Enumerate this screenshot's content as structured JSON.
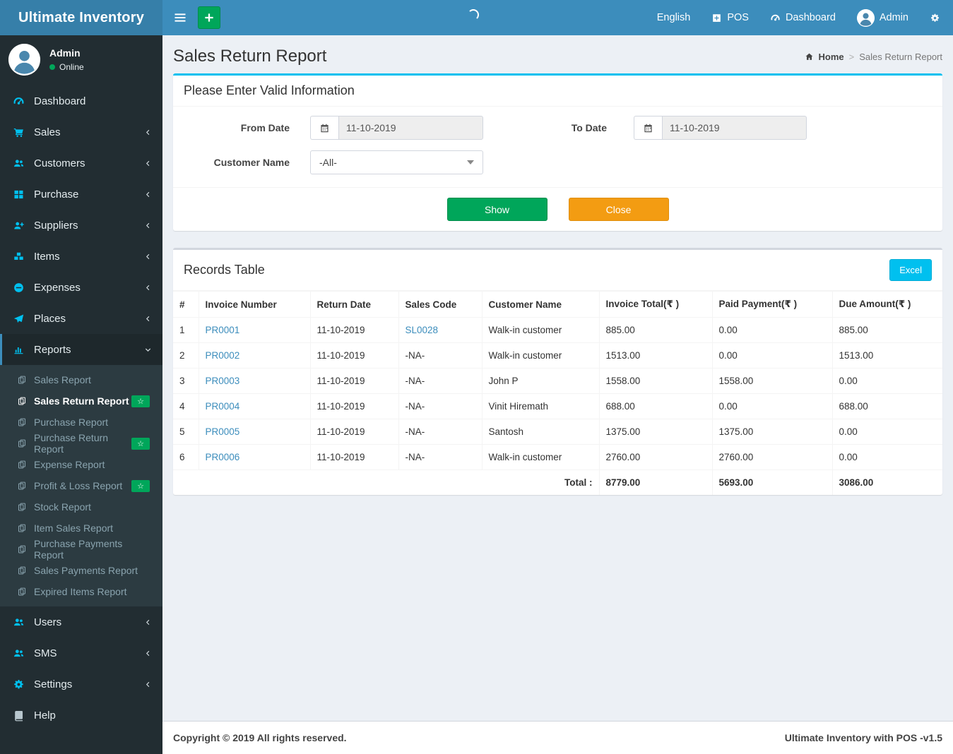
{
  "navbar": {
    "brand": "Ultimate Inventory",
    "language": "English",
    "pos_label": "POS",
    "dashboard_label": "Dashboard",
    "user_name": "Admin"
  },
  "sidebar": {
    "user": {
      "name": "Admin",
      "status": "Online"
    },
    "items": [
      {
        "key": "dashboard",
        "label": "Dashboard",
        "icon": "tachometer",
        "arrow": null
      },
      {
        "key": "sales",
        "label": "Sales",
        "icon": "cart",
        "arrow": "left"
      },
      {
        "key": "customers",
        "label": "Customers",
        "icon": "users",
        "arrow": "left"
      },
      {
        "key": "purchase",
        "label": "Purchase",
        "icon": "th-large",
        "arrow": "left"
      },
      {
        "key": "suppliers",
        "label": "Suppliers",
        "icon": "user-plus",
        "arrow": "left"
      },
      {
        "key": "items",
        "label": "Items",
        "icon": "cubes",
        "arrow": "left"
      },
      {
        "key": "expenses",
        "label": "Expenses",
        "icon": "minus-circle",
        "arrow": "left"
      },
      {
        "key": "places",
        "label": "Places",
        "icon": "paper-plane",
        "arrow": "left"
      },
      {
        "key": "reports",
        "label": "Reports",
        "icon": "bar-chart",
        "arrow": "down",
        "active": true,
        "submenu": [
          {
            "label": "Sales Report",
            "badge": false,
            "active": false
          },
          {
            "label": "Sales Return Report",
            "badge": true,
            "active": true
          },
          {
            "label": "Purchase Report",
            "badge": false,
            "active": false
          },
          {
            "label": "Purchase Return Report",
            "badge": true,
            "active": false
          },
          {
            "label": "Expense Report",
            "badge": false,
            "active": false
          },
          {
            "label": "Profit & Loss Report",
            "badge": true,
            "active": false
          },
          {
            "label": "Stock Report",
            "badge": false,
            "active": false
          },
          {
            "label": "Item Sales Report",
            "badge": false,
            "active": false
          },
          {
            "label": "Purchase Payments Report",
            "badge": false,
            "active": false
          },
          {
            "label": "Sales Payments Report",
            "badge": false,
            "active": false
          },
          {
            "label": "Expired Items Report",
            "badge": false,
            "active": false
          }
        ]
      },
      {
        "key": "users",
        "label": "Users",
        "icon": "users",
        "arrow": "left"
      },
      {
        "key": "sms",
        "label": "SMS",
        "icon": "users",
        "arrow": "left"
      },
      {
        "key": "settings",
        "label": "Settings",
        "icon": "cogs",
        "arrow": "left"
      },
      {
        "key": "help",
        "label": "Help",
        "icon": "book",
        "arrow": null,
        "icon_muted": true
      }
    ],
    "badge_glyph": "☆"
  },
  "page": {
    "title": "Sales Return Report",
    "breadcrumb": {
      "home_label": "Home",
      "current": "Sales Return Report"
    }
  },
  "filters": {
    "title": "Please Enter Valid Information",
    "from_date": {
      "label": "From Date",
      "value": "11-10-2019"
    },
    "to_date": {
      "label": "To Date",
      "value": "11-10-2019"
    },
    "customer": {
      "label": "Customer Name",
      "value": "-All-"
    },
    "show_label": "Show",
    "close_label": "Close"
  },
  "records": {
    "title": "Records Table",
    "excel_label": "Excel",
    "columns": [
      "#",
      "Invoice Number",
      "Return Date",
      "Sales Code",
      "Customer Name",
      "Invoice Total(₹ )",
      "Paid Payment(₹ )",
      "Due Amount(₹ )"
    ],
    "rows": [
      {
        "num": "1",
        "invoice": "PR0001",
        "return_date": "11-10-2019",
        "sales_code": "SL0028",
        "sales_code_link": true,
        "customer": "Walk-in customer",
        "invoice_total": "885.00",
        "paid_payment": "0.00",
        "due_amount": "885.00"
      },
      {
        "num": "2",
        "invoice": "PR0002",
        "return_date": "11-10-2019",
        "sales_code": "-NA-",
        "sales_code_link": false,
        "customer": "Walk-in customer",
        "invoice_total": "1513.00",
        "paid_payment": "0.00",
        "due_amount": "1513.00"
      },
      {
        "num": "3",
        "invoice": "PR0003",
        "return_date": "11-10-2019",
        "sales_code": "-NA-",
        "sales_code_link": false,
        "customer": "John P",
        "invoice_total": "1558.00",
        "paid_payment": "1558.00",
        "due_amount": "0.00"
      },
      {
        "num": "4",
        "invoice": "PR0004",
        "return_date": "11-10-2019",
        "sales_code": "-NA-",
        "sales_code_link": false,
        "customer": "Vinit Hiremath",
        "invoice_total": "688.00",
        "paid_payment": "0.00",
        "due_amount": "688.00"
      },
      {
        "num": "5",
        "invoice": "PR0005",
        "return_date": "11-10-2019",
        "sales_code": "-NA-",
        "sales_code_link": false,
        "customer": "Santosh",
        "invoice_total": "1375.00",
        "paid_payment": "1375.00",
        "due_amount": "0.00"
      },
      {
        "num": "6",
        "invoice": "PR0006",
        "return_date": "11-10-2019",
        "sales_code": "-NA-",
        "sales_code_link": false,
        "customer": "Walk-in customer",
        "invoice_total": "2760.00",
        "paid_payment": "2760.00",
        "due_amount": "0.00"
      }
    ],
    "total": {
      "label": "Total :",
      "invoice_total": "8779.00",
      "paid_payment": "5693.00",
      "due_amount": "3086.00"
    }
  },
  "footer": {
    "copyright": "Copyright © 2019 All rights reserved.",
    "version": "Ultimate Inventory with POS -v1.5"
  },
  "colors": {
    "navbar": "#3c8dbc",
    "logo_bg": "#367fa9",
    "sidebar_bg": "#222d32",
    "submenu_bg": "#2c3b41",
    "sidebar_icon": "#00c0ef",
    "success": "#00a65a",
    "warning": "#f39c12",
    "info": "#00c0ef",
    "link": "#3c8dbc",
    "page_bg": "#ecf0f5",
    "box_top_info": "#00c0ef",
    "box_top_default": "#d2d6de"
  }
}
